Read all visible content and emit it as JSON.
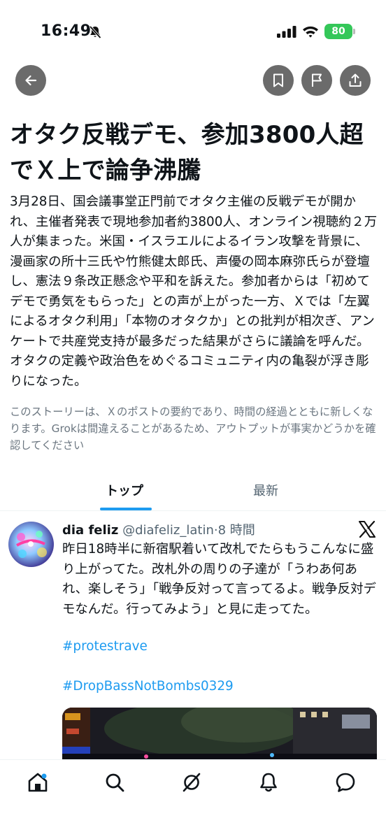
{
  "status_bar": {
    "time": "16:49",
    "battery": "80",
    "battery_color": "#34c759",
    "icons": [
      "bell-slash-icon",
      "cellular-signal-icon",
      "wifi-icon",
      "battery-icon"
    ]
  },
  "toolbar": {
    "icons": [
      "back-arrow-icon",
      "bookmark-icon",
      "flag-icon",
      "share-icon"
    ]
  },
  "story": {
    "headline": "オタク反戦デモ、参加3800人超でＸ上で論争沸騰",
    "summary": "3月28日、国会議事堂正門前でオタク主催の反戦デモが開かれ、主催者発表で現地参加者約3800人、オンライン視聴約２万人が集まった。米国・イスラエルによるイラン攻撃を背景に、漫画家の所十三氏や竹熊健太郎氏、声優の岡本麻弥氏らが登壇し、憲法９条改正懸念や平和を訴えた。参加者からは「初めてデモで勇気をもらった」との声が上がった一方、Ｘでは「左翼によるオタク利用」「本物のオタクか」との批判が相次ぎ、アンケートで共産党支持が最多だった結果がさらに議論を呼んだ。オタクの定義や政治色をめぐるコミュニティ内の亀裂が浮き彫りになった。",
    "disclaimer": "このストーリーは、Ｘのポストの要約であり、時間の経過とともに新しくなります。Grokは間違えることがあるため、アウトプットが事実かどうかを確認してください"
  },
  "tabs": [
    {
      "label": "トップ",
      "active": true
    },
    {
      "label": "最新",
      "active": false
    }
  ],
  "accent_color": "#1d9bf0",
  "post": {
    "author_name": "dia feliz",
    "author_handle": "@diafeliz_latin",
    "time": "·8 時間",
    "text": "昨日18時半に新宿駅着いて改札でたらもうこんなに盛り上がってた。改札外の周りの子達が「うわあ何あれ、楽しそう」「戦争反対って言ってるよ。戦争反対デモなんだ。行ってみよう」と見に走ってた。",
    "hashtags": [
      "#protestrave",
      "#DropBassNotBombs0329"
    ],
    "platform_icon": "x-logo-icon"
  },
  "bottom_nav": [
    "home-icon",
    "search-icon",
    "grok-icon",
    "notifications-icon",
    "messages-icon"
  ]
}
